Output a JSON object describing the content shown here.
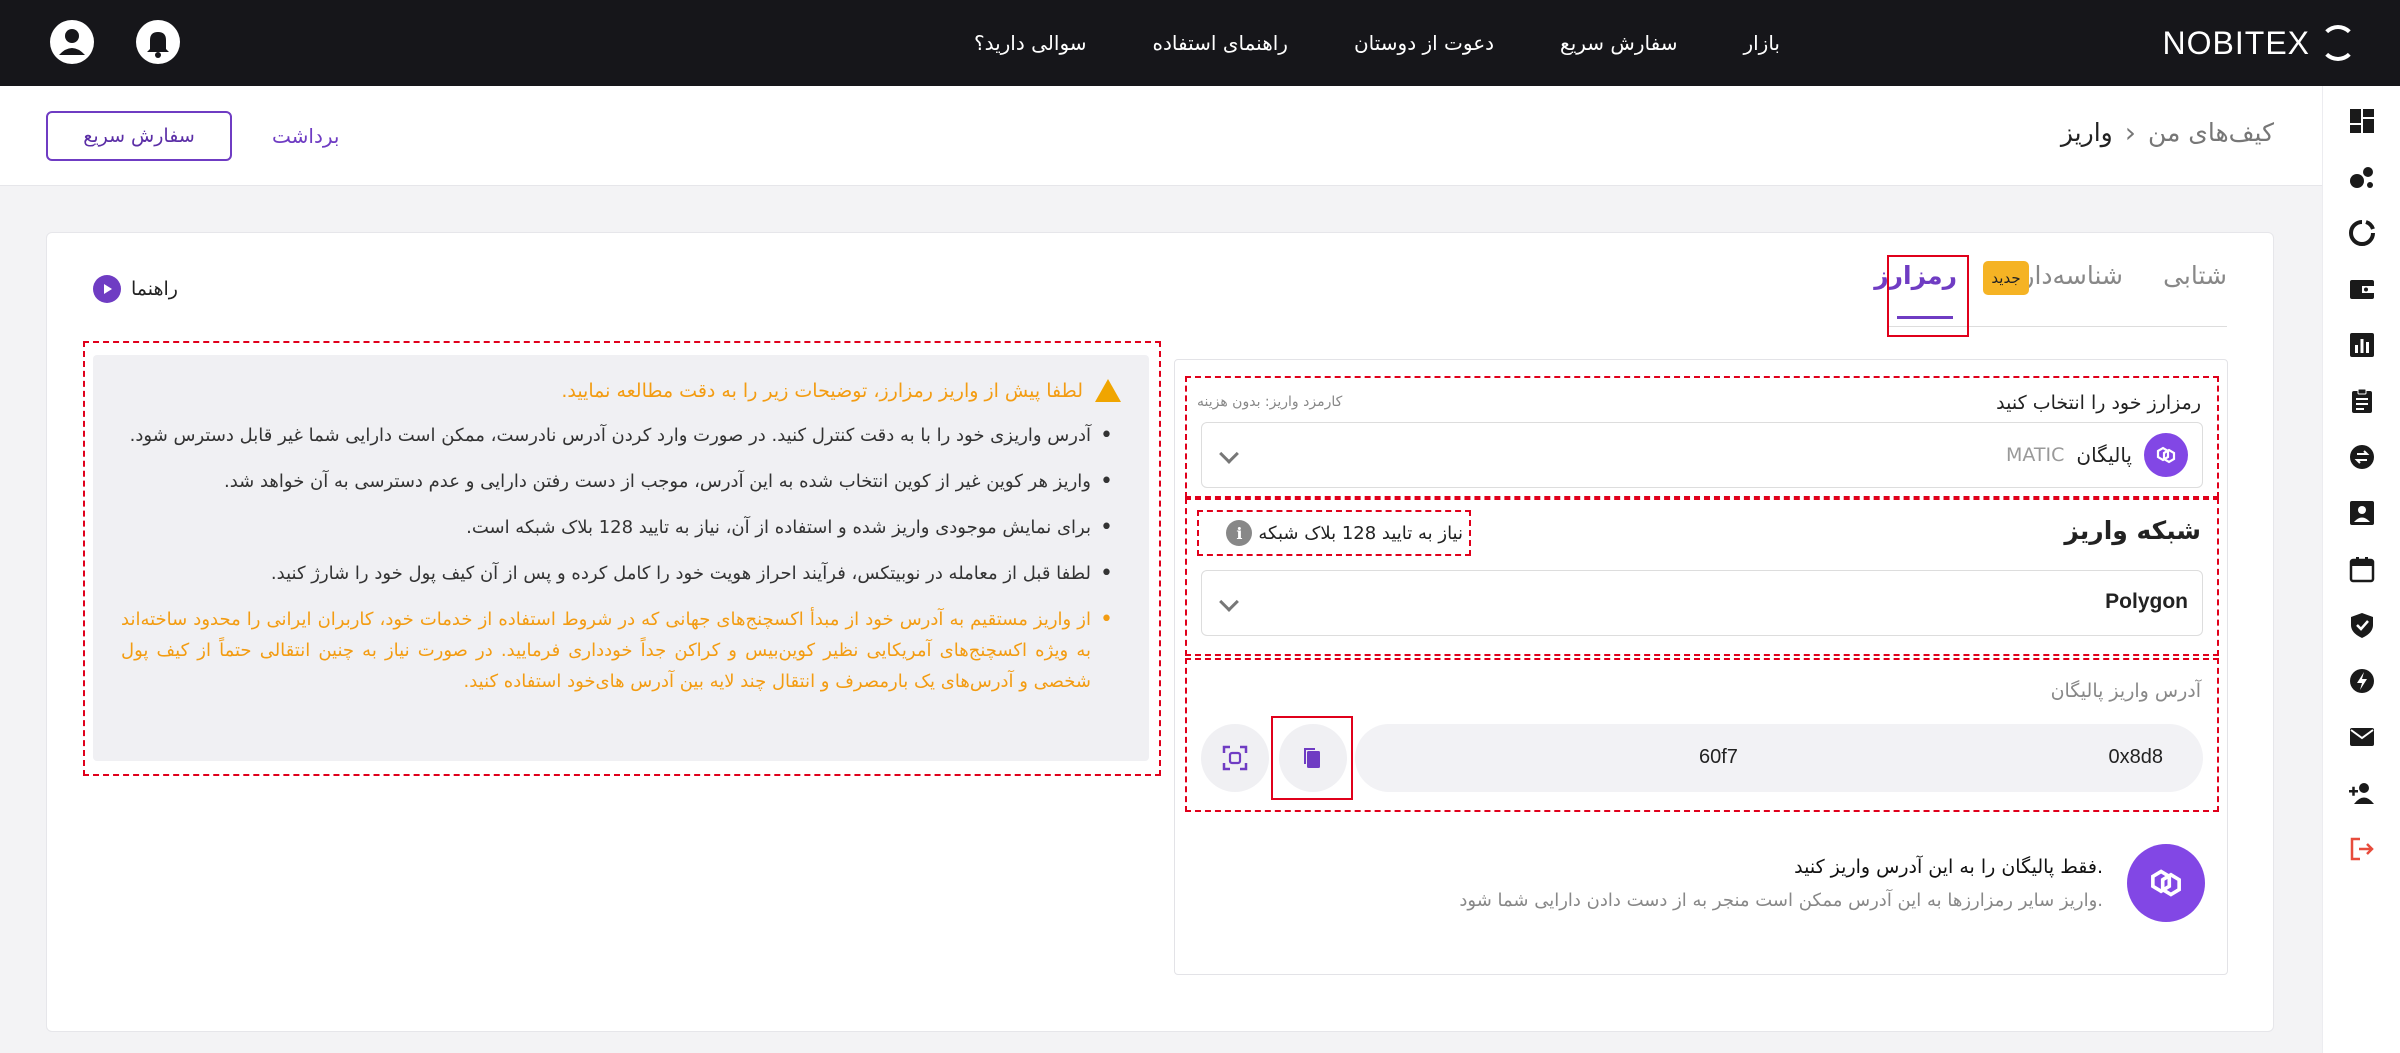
{
  "brand": {
    "name": "NOBITEX"
  },
  "topnav": {
    "items": [
      "بازار",
      "سفارش سریع",
      "دعوت از دوستان",
      "راهنمای استفاده",
      "سوالی دارید؟"
    ]
  },
  "header": {
    "breadcrumb_root": "کیف‌های من",
    "breadcrumb_sep": "›",
    "breadcrumb_current": "واریز",
    "withdraw_label": "برداشت",
    "quick_order_label": "سفارش سریع"
  },
  "tabs": {
    "quick": "شتابی",
    "id": "شناسه‌دار",
    "new_badge": "جدید",
    "crypto": "رمزارز"
  },
  "guide": {
    "label": "راهنما"
  },
  "warning": {
    "title": "لطفا پیش از واریز رمزارز، توضیحات زیر را به دقت مطالعه نمایید.",
    "items": [
      "آدرس واریزی خود را با به دقت کنترل کنید. در صورت وارد کردن آدرس نادرست، ممکن است دارایی شما غیر قابل دسترس شود.",
      "واریز هر کوین غیر از کوین انتخاب شده به این آدرس، موجب از دست رفتن دارایی و عدم دسترسی به آن خواهد شد.",
      "برای نمایش موجودی واریز شده و استفاده از آن، نیاز به تایید 128 بلاک شبکه است.",
      "لطفا قبل از معامله در نوبیتکس، فرآیند احراز هویت خود را کامل کرده و پس از آن کیف پول خود را شارژ کنید.",
      "از واریز مستقیم به آدرس خود از مبدأ اکسچنج‌های جهانی که در شروط استفاده از خدمات خود، کاربران ایرانی را محدود ساخته‌اند به ویژه اکسچنج‌های آمریکایی نظیر کوین‌بیس و کراکن جداً خودداری فرمایید. در صورت نیاز به چنین انتقالی حتماً از کیف پول شخصی و آدرس‌های یک بارمصرف و انتقال چند لایه بین آدرس های‌خود استفاده کنید."
    ]
  },
  "form": {
    "select_label": "رمزارز خود را انتخاب کنید",
    "fee_label": "کارمزد واریز: بدون هزینه",
    "coin_name": "پالیگان",
    "coin_symbol": "MATIC",
    "network_title": "شبکه واریز",
    "confirm_text": "نیاز به تایید 128 بلاک شبکه",
    "network_value": "Polygon",
    "address_label": "آدرس واریز پالیگان",
    "address_start": "0x8d8",
    "address_end": "60f7"
  },
  "note": {
    "title": "فقط پالیگان را به این آدرس واریز کنید.",
    "desc": "واریز سایر رمزارزها به این آدرس ممکن است منجر به از دست دادن دارایی شما شود."
  },
  "colors": {
    "accent": "#6f3cc3",
    "warning": "#f39c12",
    "polygon": "#8247e5",
    "highlight": "#e0001b",
    "topbar": "#16161a"
  },
  "sidebar_icons": [
    "dashboard-icon",
    "market-icon",
    "portfolio-icon",
    "wallet-icon",
    "chart-icon",
    "orders-icon",
    "convert-icon",
    "profile-icon",
    "calendar-icon",
    "security-icon",
    "flash-icon",
    "mail-icon",
    "invite-icon",
    "logout-icon"
  ]
}
